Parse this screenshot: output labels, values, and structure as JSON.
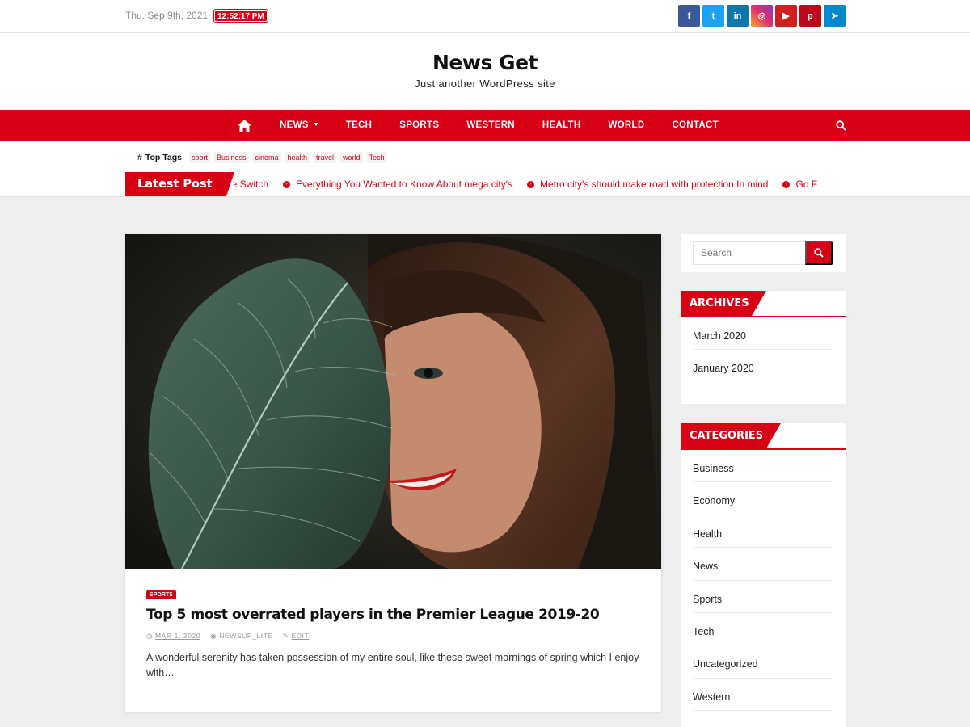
{
  "topbar": {
    "date": "Thu. Sep 9th, 2021",
    "time": "12:52:17 PM",
    "socials": [
      {
        "icon": "facebook-icon",
        "glyph": "f",
        "color": "#3b5998"
      },
      {
        "icon": "twitter-icon",
        "glyph": "t",
        "color": "#1da1f2"
      },
      {
        "icon": "linkedin-icon",
        "glyph": "in",
        "color": "#0e76a8"
      },
      {
        "icon": "instagram-icon",
        "glyph": "◎",
        "color": "#e1306c"
      },
      {
        "icon": "youtube-icon",
        "glyph": "▶",
        "color": "#cd201f"
      },
      {
        "icon": "pinterest-icon",
        "glyph": "p",
        "color": "#bd081c"
      },
      {
        "icon": "telegram-icon",
        "glyph": "➤",
        "color": "#0088cc"
      }
    ]
  },
  "site": {
    "title": "News Get",
    "description": "Just another WordPress site"
  },
  "nav": {
    "items": [
      "NEWS",
      "TECH",
      "SPORTS",
      "WESTERN",
      "HEALTH",
      "WORLD",
      "CONTACT"
    ]
  },
  "tags": {
    "label": "Top Tags",
    "items": [
      "sport",
      "Business",
      "cinema",
      "health",
      "travel",
      "world",
      "Tech"
    ]
  },
  "latest": {
    "label": "Latest Post",
    "items": [
      "he Switch",
      "Everything You Wanted to Know About mega city's",
      "Metro city's should make road with protection In mind",
      "Go F"
    ]
  },
  "post": {
    "category": "SPORTS",
    "title": "Top 5 most overrated players in the Premier League 2019-20",
    "date": "MAR 1, 2020",
    "author": "NEWSUP_LITE",
    "edit": "EDIT",
    "excerpt": "A wonderful serenity has taken possession of my entire soul, like these sweet mornings of spring which I enjoy with…"
  },
  "sidebar": {
    "search_placeholder": "Search",
    "archives": {
      "title": "ARCHIVES",
      "items": [
        "March 2020",
        "January 2020"
      ]
    },
    "categories": {
      "title": "CATEGORIES",
      "items": [
        "Business",
        "Economy",
        "Health",
        "News",
        "Sports",
        "Tech",
        "Uncategorized",
        "Western"
      ]
    }
  },
  "colors": {
    "accent": "#d70014",
    "background": "#eeeeee"
  }
}
